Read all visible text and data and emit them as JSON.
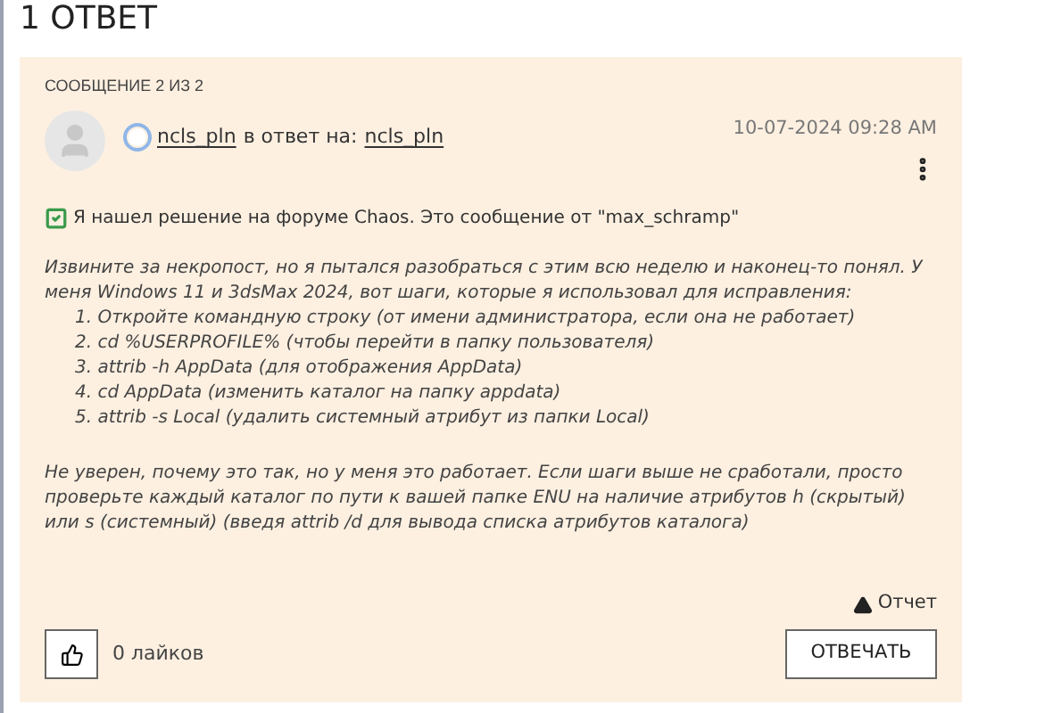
{
  "heading": "1 ОТВЕТ",
  "message": {
    "counter": "СООБЩЕНИЕ 2 ИЗ 2",
    "author": "ncls_pln",
    "reply_label": "в ответ на:",
    "reply_to": "ncls_pln",
    "timestamp": "10-07-2024 09:28 AM",
    "solution_note": "Я нашел решение на форуме Chaos. Это сообщение от \"max_schramp\"",
    "solution_checked": true,
    "intro": "Извините за некропост, но я пытался разобраться с этим всю неделю и наконец-то понял. У меня Windows 11 и 3dsMax 2024, вот шаги, которые я использовал для исправления:",
    "steps": [
      "1. Откройте командную строку (от имени администратора, если она не работает)",
      "2. cd %USERPROFILE% (чтобы перейти в папку пользователя)",
      "3. attrib -h AppData (для отображения AppData)",
      "4. cd AppData (изменить каталог на папку appdata)",
      "5. attrib -s Local (удалить системный атрибут из папки Local)"
    ],
    "outro": "Не уверен, почему это так, но у меня это работает. Если шаги выше не сработали, просто проверьте каждый каталог по пути к вашей папке ENU на наличие атрибутов h (скрытый) или s (системный) (введя attrib /d для вывода списка атрибутов каталога)",
    "report": "Отчет",
    "likes": "0 лайков",
    "reply_button": "ОТВЕЧАТЬ"
  }
}
